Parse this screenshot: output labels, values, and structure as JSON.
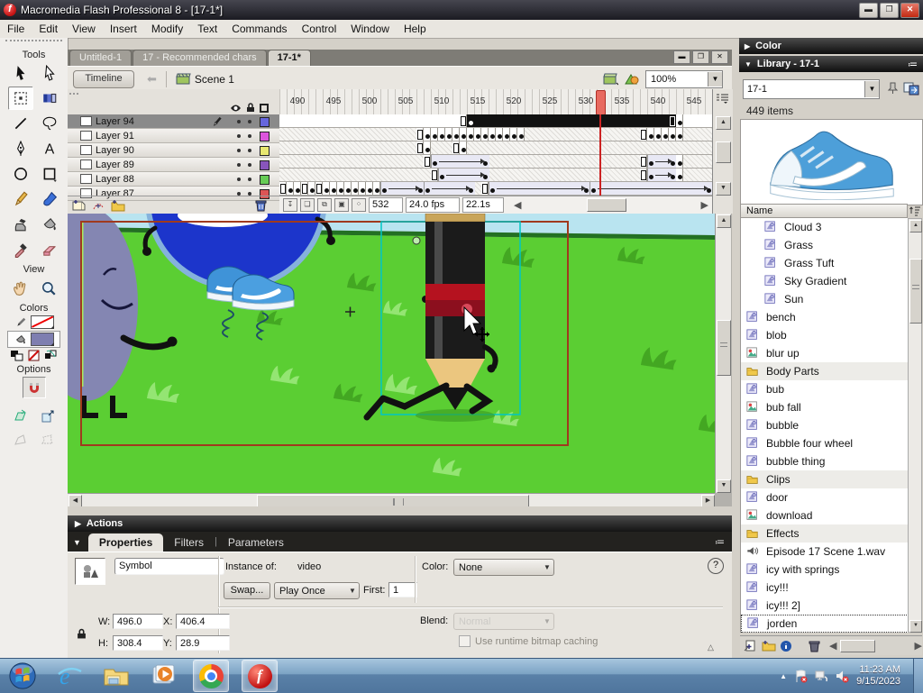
{
  "window": {
    "title": "Macromedia Flash Professional 8 - [17-1*]",
    "menus": [
      "File",
      "Edit",
      "View",
      "Insert",
      "Modify",
      "Text",
      "Commands",
      "Control",
      "Window",
      "Help"
    ]
  },
  "document_tabs": [
    "Untitled-1",
    "17 - Recommended chars",
    "17-1*"
  ],
  "active_tab_index": 2,
  "edit_bar": {
    "timeline_button": "Timeline",
    "scene_label": "Scene 1",
    "zoom_value": "100%"
  },
  "tools_panel": {
    "tools_label": "Tools",
    "view_label": "View",
    "colors_label": "Colors",
    "options_label": "Options",
    "items": [
      "selection-tool",
      "subselection-tool",
      "free-transform-tool",
      "gradient-transform-tool",
      "line-tool",
      "lasso-tool",
      "pen-tool",
      "text-tool",
      "oval-tool",
      "rectangle-tool",
      "pencil-tool",
      "brush-tool",
      "ink-bottle-tool",
      "paint-bucket-tool",
      "eyedropper-tool",
      "eraser-tool"
    ],
    "view_items": [
      "hand-tool",
      "zoom-tool"
    ],
    "selected_tool": "free-transform-tool"
  },
  "timeline": {
    "first_frame": 488,
    "ruler_labels": [
      490,
      495,
      500,
      505,
      510,
      515,
      520,
      525,
      530,
      535,
      540,
      545
    ],
    "playhead_frame": 532,
    "status": {
      "current_frame": "532",
      "frame_rate": "24.0 fps",
      "elapsed_time": "22.1s"
    },
    "layers": [
      {
        "name": "Layer 94",
        "color": "#6666DD",
        "selected": true,
        "bg": "white",
        "segments": [
          {
            "t": "rect",
            "f": 513
          },
          {
            "t": "black",
            "f": 514,
            "to": 542
          },
          {
            "t": "key",
            "f": 543
          }
        ]
      },
      {
        "name": "Layer 91",
        "color": "#DD55DD",
        "selected": false,
        "bg": "hatch",
        "segments": [
          {
            "t": "rect",
            "f": 507
          },
          {
            "t": "keys",
            "f": 508,
            "to": 521
          },
          {
            "t": "rect",
            "f": 538
          },
          {
            "t": "keys",
            "f": 539,
            "to": 543
          }
        ]
      },
      {
        "name": "Layer 90",
        "color": "#E8E870",
        "selected": false,
        "bg": "hatch",
        "segments": [
          {
            "t": "rect",
            "f": 507
          },
          {
            "t": "key",
            "f": 508
          },
          {
            "t": "rect",
            "f": 512
          },
          {
            "t": "key",
            "f": 513
          }
        ]
      },
      {
        "name": "Layer 89",
        "color": "#8855BB",
        "selected": false,
        "bg": "hatch",
        "segments": [
          {
            "t": "rect",
            "f": 508
          },
          {
            "t": "tween",
            "f": 509,
            "to": 516
          },
          {
            "t": "rect",
            "f": 538
          },
          {
            "t": "tween",
            "f": 539,
            "to": 542
          },
          {
            "t": "key",
            "f": 543
          }
        ]
      },
      {
        "name": "Layer 88",
        "color": "#66CC55",
        "selected": false,
        "bg": "hatch",
        "segments": [
          {
            "t": "rect",
            "f": 509
          },
          {
            "t": "tween",
            "f": 510,
            "to": 516
          },
          {
            "t": "rect",
            "f": 538
          },
          {
            "t": "tween",
            "f": 539,
            "to": 542
          },
          {
            "t": "key",
            "f": 543
          }
        ]
      },
      {
        "name": "Layer 87",
        "color": "#DD5555",
        "selected": false,
        "bg": "hatch",
        "segments": [
          {
            "t": "rect",
            "f": 488
          },
          {
            "t": "keys",
            "f": 489,
            "to": 490
          },
          {
            "t": "rect",
            "f": 491
          },
          {
            "t": "key",
            "f": 492
          },
          {
            "t": "rect",
            "f": 493
          },
          {
            "t": "keys",
            "f": 494,
            "to": 501
          },
          {
            "t": "tween",
            "f": 502,
            "to": 507
          },
          {
            "t": "tween",
            "f": 508,
            "to": 514
          },
          {
            "t": "rect",
            "f": 516
          },
          {
            "t": "tween",
            "f": 517,
            "to": 530
          },
          {
            "t": "tween",
            "f": 531,
            "to": 547
          }
        ]
      }
    ]
  },
  "actions_panel": {
    "title": "Actions"
  },
  "properties": {
    "tabs": [
      "Properties",
      "Filters",
      "Parameters"
    ],
    "symbol_label": "Symbol",
    "instance_of_label": "Instance of:",
    "instance_of_value": "video",
    "swap_button": "Swap...",
    "loop_mode": "Play Once",
    "first_label": "First:",
    "first_value": "1",
    "color_label": "Color:",
    "color_value": "None",
    "blend_label": "Blend:",
    "blend_value": "Normal",
    "bitmap_caching_label": "Use runtime bitmap caching",
    "w_label": "W:",
    "w_value": "496.0",
    "h_label": "H:",
    "h_value": "308.4",
    "x_label": "X:",
    "x_value": "406.4",
    "y_label": "Y:",
    "y_value": "28.9"
  },
  "library": {
    "color_panel_title": "Color",
    "panel_title": "Library - 17-1",
    "document_selector": "17-1",
    "item_count": "449 items",
    "name_column": "Name",
    "items": [
      {
        "label": "Cloud 3",
        "icon": "graphic-symbol-icon",
        "indent": 1
      },
      {
        "label": "Grass",
        "icon": "graphic-symbol-icon",
        "indent": 1
      },
      {
        "label": "Grass Tuft",
        "icon": "graphic-symbol-icon",
        "indent": 1
      },
      {
        "label": "Sky Gradient",
        "icon": "graphic-symbol-icon",
        "indent": 1
      },
      {
        "label": "Sun",
        "icon": "graphic-symbol-icon",
        "indent": 1
      },
      {
        "label": "bench",
        "icon": "graphic-symbol-icon",
        "indent": 0
      },
      {
        "label": "blob",
        "icon": "graphic-symbol-icon",
        "indent": 0
      },
      {
        "label": "blur up",
        "icon": "bitmap-icon",
        "indent": 0
      },
      {
        "label": "Body Parts",
        "icon": "folder-icon",
        "indent": 0
      },
      {
        "label": "bub",
        "icon": "graphic-symbol-icon",
        "indent": 0
      },
      {
        "label": "bub fall",
        "icon": "bitmap-icon",
        "indent": 0
      },
      {
        "label": "bubble",
        "icon": "graphic-symbol-icon",
        "indent": 0
      },
      {
        "label": "Bubble four wheel",
        "icon": "graphic-symbol-icon",
        "indent": 0
      },
      {
        "label": "bubble thing",
        "icon": "graphic-symbol-icon",
        "indent": 0
      },
      {
        "label": "Clips",
        "icon": "folder-icon",
        "indent": 0
      },
      {
        "label": "door",
        "icon": "graphic-symbol-icon",
        "indent": 0
      },
      {
        "label": "download",
        "icon": "bitmap-icon",
        "indent": 0
      },
      {
        "label": "Effects",
        "icon": "folder-icon",
        "indent": 0
      },
      {
        "label": "Episode 17 Scene 1.wav",
        "icon": "sound-icon",
        "indent": 0
      },
      {
        "label": "icy with springs",
        "icon": "graphic-symbol-icon",
        "indent": 0
      },
      {
        "label": "icy!!!",
        "icon": "graphic-symbol-icon",
        "indent": 0
      },
      {
        "label": "icy!!! 2]",
        "icon": "graphic-symbol-icon",
        "indent": 0
      },
      {
        "label": "jorden",
        "icon": "graphic-symbol-icon",
        "indent": 0,
        "selected": true
      }
    ]
  },
  "taskbar": {
    "time": "11:23 AM",
    "date": "9/15/2023"
  },
  "colors": {
    "stage_green": "#5BCE33",
    "sky_blue": "#B9E4F0",
    "horizon_green": "#237023",
    "selection_cyan": "#00C6C6",
    "stage_border_red": "#A03A1E",
    "layer_selected_bg": "#8A8A8A",
    "panel_header_bg": "#1B1B1B"
  }
}
